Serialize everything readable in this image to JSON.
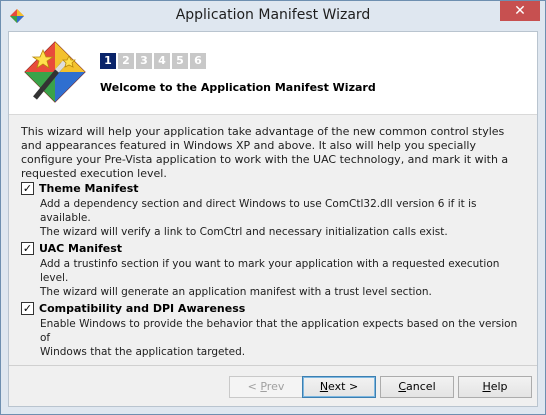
{
  "window": {
    "title": "Application Manifest Wizard",
    "close_glyph": "✕"
  },
  "header": {
    "steps": [
      "1",
      "2",
      "3",
      "4",
      "5",
      "6"
    ],
    "active_step": "1",
    "title": "Welcome to the Application Manifest Wizard"
  },
  "intro": "This wizard will help your application take advantage of the new common control styles and appearances featured in Windows XP and above. It also will help you specially configure your Pre-Vista application to work with the UAC technology, and mark it with a requested execution level.",
  "options": [
    {
      "label": "Theme Manifest",
      "checked": true,
      "desc1": "Add a dependency section and direct Windows to use ComCtl32.dll version 6 if it is available.",
      "desc2": "The wizard will verify a link to ComCtrl and necessary initialization calls exist."
    },
    {
      "label": "UAC Manifest",
      "checked": true,
      "desc1": "Add a trustinfo section if you want to mark your application with a requested execution level.",
      "desc2": "The wizard will generate an application manifest with a trust level section."
    },
    {
      "label": "Compatibility and DPI Awareness",
      "checked": true,
      "desc1": "Enable Windows to provide the behavior that the application expects based on the version of",
      "desc2": "Windows that the application targeted."
    }
  ],
  "buttons": {
    "prev_key": "P",
    "prev_rest": "rev",
    "prev_prefix": "< ",
    "next_key": "N",
    "next_rest": "ext >",
    "cancel_key": "C",
    "cancel_rest": "ancel",
    "help_key": "H",
    "help_rest": "elp"
  },
  "check_glyph": "✓",
  "colors": {
    "active_step": "#0a246a",
    "inactive_step": "#c8c8c8",
    "close_button": "#c75050"
  },
  "icons": [
    "app-wizard-icon",
    "wizard-logo-icon",
    "close-icon",
    "checkbox-icon"
  ]
}
